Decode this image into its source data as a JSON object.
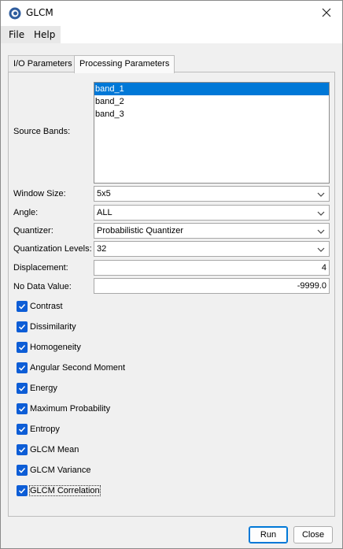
{
  "window": {
    "title": "GLCM",
    "close_icon": "close-icon",
    "app_icon": "snap-app-icon"
  },
  "menu": {
    "items": [
      {
        "label": "File"
      },
      {
        "label": "Help"
      }
    ]
  },
  "tabs": [
    {
      "label": "I/O Parameters",
      "active": false
    },
    {
      "label": "Processing Parameters",
      "active": true
    }
  ],
  "form": {
    "source_bands": {
      "label": "Source Bands:",
      "items": [
        "band_1",
        "band_2",
        "band_3"
      ],
      "selected_index": 0
    },
    "window_size": {
      "label": "Window Size:",
      "value": "5x5"
    },
    "angle": {
      "label": "Angle:",
      "value": "ALL"
    },
    "quantizer": {
      "label": "Quantizer:",
      "value": "Probabilistic Quantizer"
    },
    "quantization_levels": {
      "label": "Quantization Levels:",
      "value": "32"
    },
    "displacement": {
      "label": "Displacement:",
      "value": "4"
    },
    "no_data_value": {
      "label": "No Data Value:",
      "value": "-9999.0"
    }
  },
  "features": [
    {
      "label": "Contrast",
      "checked": true
    },
    {
      "label": "Dissimilarity",
      "checked": true
    },
    {
      "label": "Homogeneity",
      "checked": true
    },
    {
      "label": "Angular Second Moment",
      "checked": true
    },
    {
      "label": "Energy",
      "checked": true
    },
    {
      "label": "Maximum Probability",
      "checked": true
    },
    {
      "label": "Entropy",
      "checked": true
    },
    {
      "label": "GLCM Mean",
      "checked": true
    },
    {
      "label": "GLCM Variance",
      "checked": true
    },
    {
      "label": "GLCM Correlation",
      "checked": true,
      "focused": true
    }
  ],
  "buttons": {
    "run": "Run",
    "close": "Close"
  },
  "colors": {
    "selection": "#0078d7",
    "checkbox": "#0d5dd6"
  }
}
